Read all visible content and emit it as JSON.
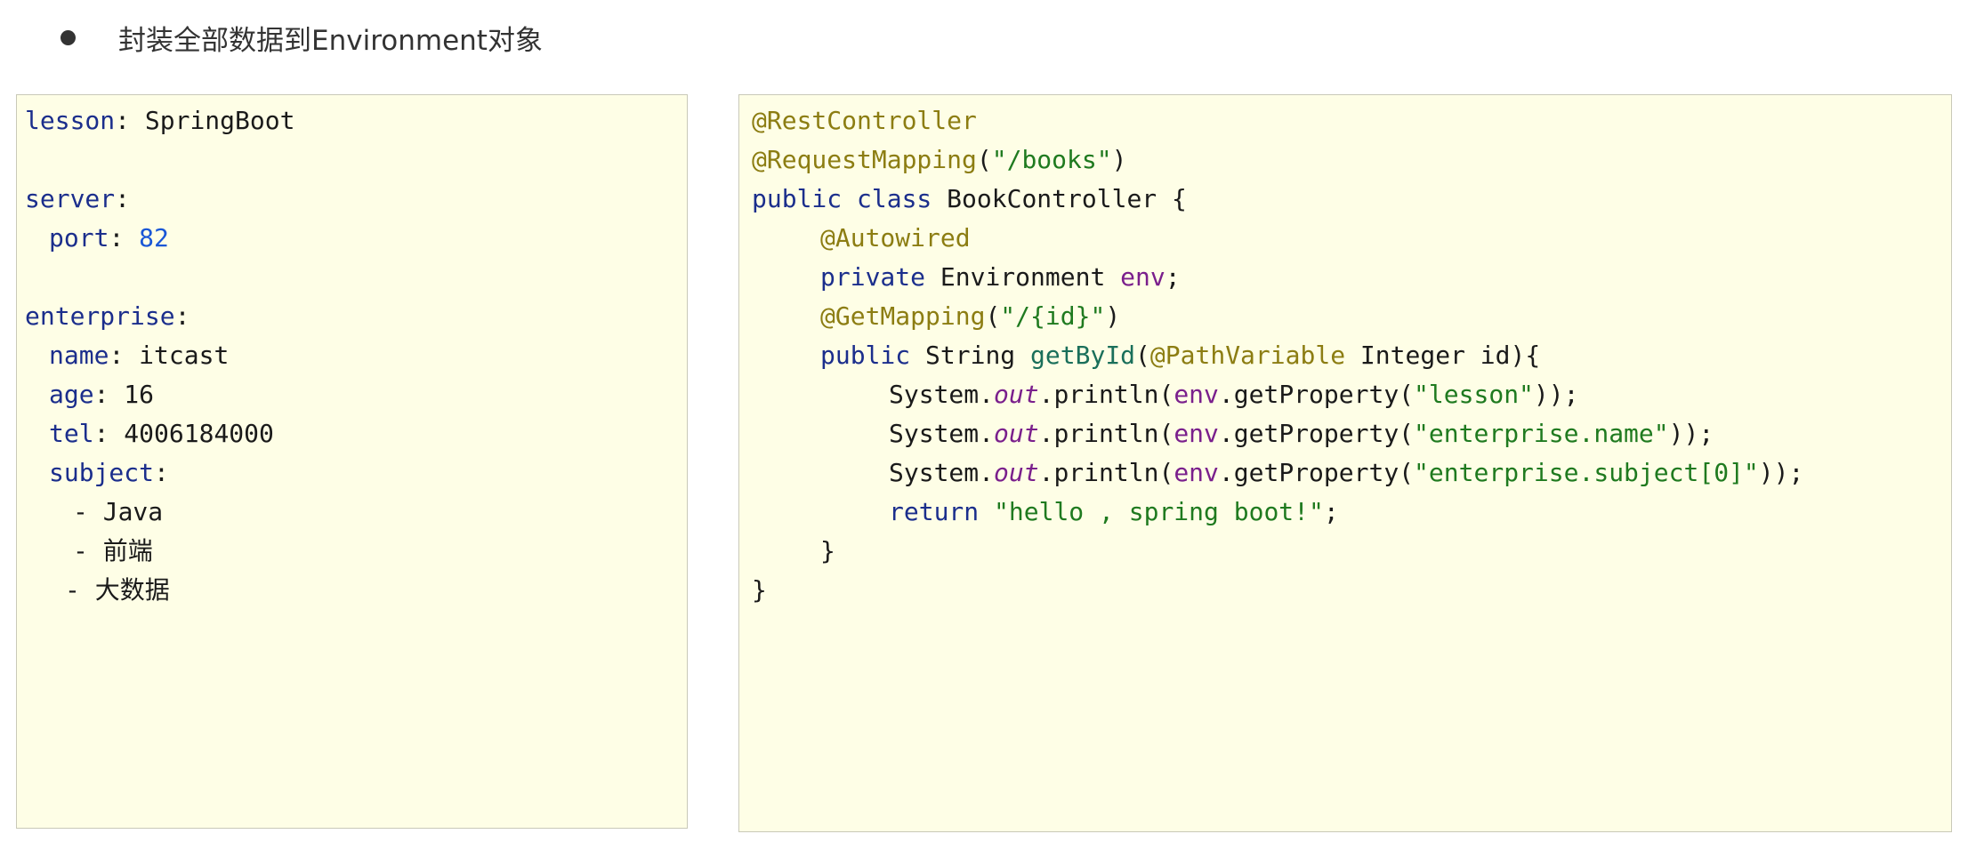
{
  "header": {
    "bullet_text": "封装全部数据到Environment对象"
  },
  "yaml": {
    "lesson_key": "lesson",
    "lesson_value": "SpringBoot",
    "server_key": "server",
    "port_key": "port",
    "port_value": "82",
    "enterprise_key": "enterprise",
    "name_key": "name",
    "name_value": "itcast",
    "age_key": "age",
    "age_value": "16",
    "tel_key": "tel",
    "tel_value": "4006184000",
    "subject_key": "subject",
    "subject_items": [
      "Java",
      "前端",
      "大数据"
    ]
  },
  "java": {
    "l1_ann": "@RestController",
    "l2_ann": "@RequestMapping",
    "l2_str": "\"/books\"",
    "l3_kw": "public class",
    "l3_name": "BookController {",
    "l4_ann": "@Autowired",
    "l5_kw": "private",
    "l5_type": "Environment",
    "l5_field": "env",
    "l6_ann": "@GetMapping",
    "l6_str": "\"/{id}\"",
    "l7_kw": "public",
    "l7_type": "String",
    "l7_method": "getById",
    "l7_ann": "@PathVariable",
    "l7_rest": "Integer id){",
    "sys": "System.",
    "out": "out",
    "println": ".println(",
    "env_ref": "env",
    "getprop": ".getProperty(",
    "p1": "\"lesson\"",
    "p2": "\"enterprise.name\"",
    "p3": "\"enterprise.subject[0]\"",
    "close_call": "));",
    "return_kw": "return",
    "return_str": "\"hello , spring boot!\"",
    "semi": ";",
    "close_method": "}",
    "close_class": "}"
  }
}
